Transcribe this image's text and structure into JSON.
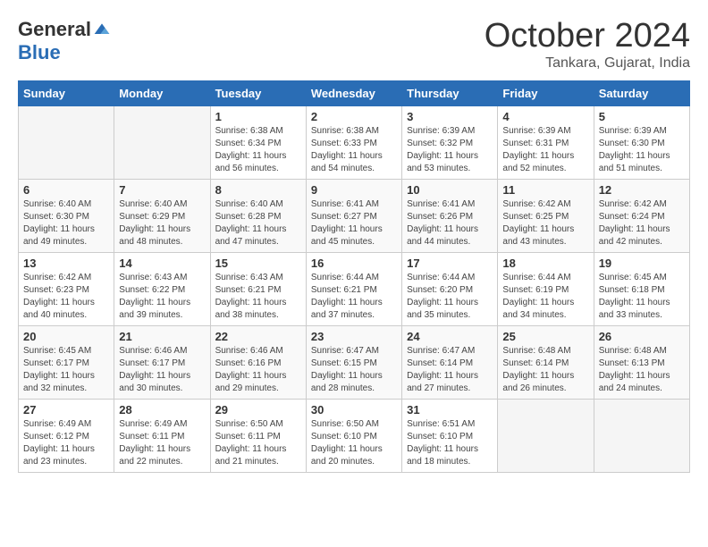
{
  "header": {
    "logo_general": "General",
    "logo_blue": "Blue",
    "month": "October 2024",
    "location": "Tankara, Gujarat, India"
  },
  "weekdays": [
    "Sunday",
    "Monday",
    "Tuesday",
    "Wednesday",
    "Thursday",
    "Friday",
    "Saturday"
  ],
  "weeks": [
    [
      {
        "day": "",
        "info": ""
      },
      {
        "day": "",
        "info": ""
      },
      {
        "day": "1",
        "info": "Sunrise: 6:38 AM\nSunset: 6:34 PM\nDaylight: 11 hours and 56 minutes."
      },
      {
        "day": "2",
        "info": "Sunrise: 6:38 AM\nSunset: 6:33 PM\nDaylight: 11 hours and 54 minutes."
      },
      {
        "day": "3",
        "info": "Sunrise: 6:39 AM\nSunset: 6:32 PM\nDaylight: 11 hours and 53 minutes."
      },
      {
        "day": "4",
        "info": "Sunrise: 6:39 AM\nSunset: 6:31 PM\nDaylight: 11 hours and 52 minutes."
      },
      {
        "day": "5",
        "info": "Sunrise: 6:39 AM\nSunset: 6:30 PM\nDaylight: 11 hours and 51 minutes."
      }
    ],
    [
      {
        "day": "6",
        "info": "Sunrise: 6:40 AM\nSunset: 6:30 PM\nDaylight: 11 hours and 49 minutes."
      },
      {
        "day": "7",
        "info": "Sunrise: 6:40 AM\nSunset: 6:29 PM\nDaylight: 11 hours and 48 minutes."
      },
      {
        "day": "8",
        "info": "Sunrise: 6:40 AM\nSunset: 6:28 PM\nDaylight: 11 hours and 47 minutes."
      },
      {
        "day": "9",
        "info": "Sunrise: 6:41 AM\nSunset: 6:27 PM\nDaylight: 11 hours and 45 minutes."
      },
      {
        "day": "10",
        "info": "Sunrise: 6:41 AM\nSunset: 6:26 PM\nDaylight: 11 hours and 44 minutes."
      },
      {
        "day": "11",
        "info": "Sunrise: 6:42 AM\nSunset: 6:25 PM\nDaylight: 11 hours and 43 minutes."
      },
      {
        "day": "12",
        "info": "Sunrise: 6:42 AM\nSunset: 6:24 PM\nDaylight: 11 hours and 42 minutes."
      }
    ],
    [
      {
        "day": "13",
        "info": "Sunrise: 6:42 AM\nSunset: 6:23 PM\nDaylight: 11 hours and 40 minutes."
      },
      {
        "day": "14",
        "info": "Sunrise: 6:43 AM\nSunset: 6:22 PM\nDaylight: 11 hours and 39 minutes."
      },
      {
        "day": "15",
        "info": "Sunrise: 6:43 AM\nSunset: 6:21 PM\nDaylight: 11 hours and 38 minutes."
      },
      {
        "day": "16",
        "info": "Sunrise: 6:44 AM\nSunset: 6:21 PM\nDaylight: 11 hours and 37 minutes."
      },
      {
        "day": "17",
        "info": "Sunrise: 6:44 AM\nSunset: 6:20 PM\nDaylight: 11 hours and 35 minutes."
      },
      {
        "day": "18",
        "info": "Sunrise: 6:44 AM\nSunset: 6:19 PM\nDaylight: 11 hours and 34 minutes."
      },
      {
        "day": "19",
        "info": "Sunrise: 6:45 AM\nSunset: 6:18 PM\nDaylight: 11 hours and 33 minutes."
      }
    ],
    [
      {
        "day": "20",
        "info": "Sunrise: 6:45 AM\nSunset: 6:17 PM\nDaylight: 11 hours and 32 minutes."
      },
      {
        "day": "21",
        "info": "Sunrise: 6:46 AM\nSunset: 6:17 PM\nDaylight: 11 hours and 30 minutes."
      },
      {
        "day": "22",
        "info": "Sunrise: 6:46 AM\nSunset: 6:16 PM\nDaylight: 11 hours and 29 minutes."
      },
      {
        "day": "23",
        "info": "Sunrise: 6:47 AM\nSunset: 6:15 PM\nDaylight: 11 hours and 28 minutes."
      },
      {
        "day": "24",
        "info": "Sunrise: 6:47 AM\nSunset: 6:14 PM\nDaylight: 11 hours and 27 minutes."
      },
      {
        "day": "25",
        "info": "Sunrise: 6:48 AM\nSunset: 6:14 PM\nDaylight: 11 hours and 26 minutes."
      },
      {
        "day": "26",
        "info": "Sunrise: 6:48 AM\nSunset: 6:13 PM\nDaylight: 11 hours and 24 minutes."
      }
    ],
    [
      {
        "day": "27",
        "info": "Sunrise: 6:49 AM\nSunset: 6:12 PM\nDaylight: 11 hours and 23 minutes."
      },
      {
        "day": "28",
        "info": "Sunrise: 6:49 AM\nSunset: 6:11 PM\nDaylight: 11 hours and 22 minutes."
      },
      {
        "day": "29",
        "info": "Sunrise: 6:50 AM\nSunset: 6:11 PM\nDaylight: 11 hours and 21 minutes."
      },
      {
        "day": "30",
        "info": "Sunrise: 6:50 AM\nSunset: 6:10 PM\nDaylight: 11 hours and 20 minutes."
      },
      {
        "day": "31",
        "info": "Sunrise: 6:51 AM\nSunset: 6:10 PM\nDaylight: 11 hours and 18 minutes."
      },
      {
        "day": "",
        "info": ""
      },
      {
        "day": "",
        "info": ""
      }
    ]
  ]
}
